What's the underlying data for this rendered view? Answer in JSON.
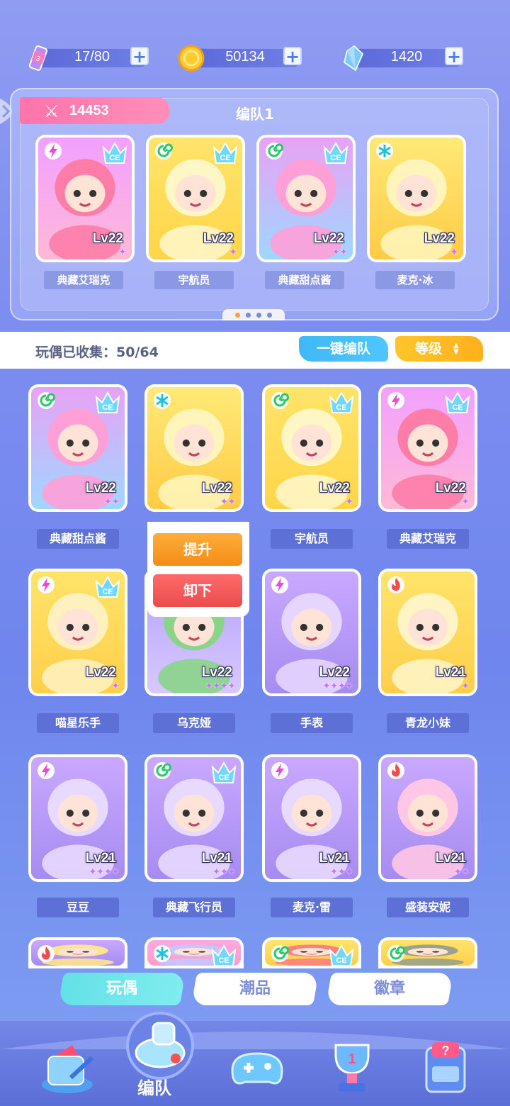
{
  "resources": [
    {
      "name": "stamina",
      "value": "17/80",
      "plus": "+"
    },
    {
      "name": "coins",
      "value": "50134",
      "plus": "+"
    },
    {
      "name": "crystals",
      "value": "1420",
      "plus": "+"
    }
  ],
  "team": {
    "power": "14453",
    "name": "编队1",
    "members": [
      {
        "name": "典藏艾瑞克",
        "level": "Lv22",
        "stars": "✦",
        "element": "lightning",
        "ce": true,
        "colors": [
          "#f2a0ff",
          "#fd7da8",
          "#ffb9d6"
        ]
      },
      {
        "name": "宇航员",
        "level": "Lv22",
        "stars": "✦",
        "element": "wind",
        "ce": true,
        "colors": [
          "#ffe46a",
          "#fff6c6",
          "#ffd548"
        ]
      },
      {
        "name": "典藏甜点酱",
        "level": "Lv22",
        "stars": "✦✦",
        "element": "wind",
        "ce": true,
        "colors": [
          "#e8a2f5",
          "#ff9fd8",
          "#9ed7ff"
        ]
      },
      {
        "name": "麦克·冰",
        "level": "Lv22",
        "stars": "✦",
        "element": "ice",
        "ce": false,
        "colors": [
          "#ffe977",
          "#fff4b9",
          "#ffcb45"
        ]
      }
    ],
    "page_dots": 4,
    "active_dot": 0
  },
  "collection": {
    "label": "玩偶已收集：50/64",
    "auto_button": "一键编队",
    "sort_button": "等级",
    "sort_arrows": "▲▼"
  },
  "dolls": [
    {
      "name": "典藏甜点酱",
      "level": "Lv22",
      "stars": "✦✦",
      "element": "wind",
      "ce": true,
      "colors": [
        "#e8a2f5",
        "#ff9fd8",
        "#9ed7ff"
      ]
    },
    {
      "name": "",
      "level": "Lv22",
      "stars": "✦✦",
      "element": "ice",
      "ce": false,
      "colors": [
        "#ffe977",
        "#fff4b9",
        "#ffcb45"
      ]
    },
    {
      "name": "宇航员",
      "level": "Lv22",
      "stars": "✦",
      "element": "wind",
      "ce": true,
      "colors": [
        "#ffe46a",
        "#fff6c6",
        "#ffd548"
      ]
    },
    {
      "name": "典藏艾瑞克",
      "level": "Lv22",
      "stars": "✦",
      "element": "lightning",
      "ce": true,
      "colors": [
        "#f2a0ff",
        "#fd7da8",
        "#ffb9d6"
      ]
    },
    {
      "name": "喵星乐手",
      "level": "Lv22",
      "stars": "✦",
      "element": "lightning",
      "ce": true,
      "colors": [
        "#ffe46a",
        "#fff1bd",
        "#ffcf4a"
      ]
    },
    {
      "name": "乌克娅",
      "level": "Lv22",
      "stars": "✦✦✦✦",
      "element": "",
      "ce": false,
      "colors": [
        "#b6a2ff",
        "#8ad489",
        "#d8c8ff"
      ]
    },
    {
      "name": "手表",
      "level": "Lv22",
      "stars": "✦✦✦✦",
      "element": "lightning",
      "ce": false,
      "colors": [
        "#c9a8ff",
        "#e6d6ff",
        "#a58cf0"
      ]
    },
    {
      "name": "青龙小妹",
      "level": "Lv21",
      "stars": "✦",
      "element": "fire",
      "ce": false,
      "colors": [
        "#ffe46a",
        "#fff4c4",
        "#ffce4a"
      ]
    },
    {
      "name": "豆豆",
      "level": "Lv21",
      "stars": "✦✦✦✦",
      "element": "lightning",
      "ce": false,
      "colors": [
        "#c9a8ff",
        "#e7d9ff",
        "#a58cf0"
      ]
    },
    {
      "name": "典藏飞行员",
      "level": "Lv21",
      "stars": "✦✦✦",
      "element": "wind",
      "ce": true,
      "colors": [
        "#c9a8ff",
        "#e7d9ff",
        "#a58cf0"
      ]
    },
    {
      "name": "麦克·雷",
      "level": "Lv21",
      "stars": "✦✦✦",
      "element": "lightning",
      "ce": false,
      "colors": [
        "#c9a8ff",
        "#e7d9ff",
        "#a58cf0"
      ]
    },
    {
      "name": "盛装安妮",
      "level": "Lv21",
      "stars": "✦✦",
      "element": "fire",
      "ce": false,
      "colors": [
        "#c9a8ff",
        "#ffc6e6",
        "#a58cf0"
      ]
    },
    {
      "name": "",
      "level": "",
      "stars": "",
      "element": "fire",
      "ce": false,
      "colors": [
        "#c9a8ff",
        "#ffe48a",
        "#a58cf0"
      ]
    },
    {
      "name": "",
      "level": "",
      "stars": "",
      "element": "ice",
      "ce": true,
      "colors": [
        "#ffa8e0",
        "#c2c8ff",
        "#ff9ccc"
      ]
    },
    {
      "name": "",
      "level": "",
      "stars": "",
      "element": "wind",
      "ce": true,
      "colors": [
        "#ffe46a",
        "#ff7f7f",
        "#ffcf4a"
      ]
    },
    {
      "name": "",
      "level": "",
      "stars": "",
      "element": "wind",
      "ce": false,
      "colors": [
        "#ffe46a",
        "#9aa28b",
        "#ffcf4a"
      ]
    }
  ],
  "popup": {
    "upgrade": "提升",
    "remove": "卸下"
  },
  "tabs": [
    {
      "label": "玩偶",
      "active": true
    },
    {
      "label": "潮品",
      "active": false
    },
    {
      "label": "徽章",
      "active": false
    }
  ],
  "bottom_nav": {
    "active_label": "编队",
    "items": [
      "gacha-icon",
      "team-whistle-icon",
      "gamepad-icon",
      "trophy-icon",
      "mystery-box-icon"
    ]
  },
  "colors": {
    "lightning": "#e94ad6",
    "wind": "#28c96a",
    "ice": "#1fc3d9",
    "fire": "#f24b4b",
    "accent_orange": "#ff9e3d",
    "accent_cyan": "#63e1e6"
  }
}
